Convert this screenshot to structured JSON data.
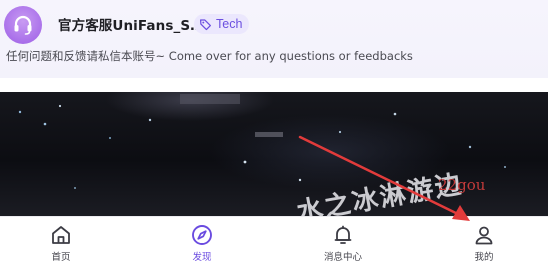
{
  "header": {
    "account_name": "官方客服UniFans_S…",
    "tag": {
      "label": "Tech",
      "icon": "tag-icon"
    },
    "bio": "任何问题和反馈请私信本账号~ Come over for any questions or feedbacks",
    "avatar_icon": "headset-icon"
  },
  "banner": {
    "watermark": "22gou",
    "overlay_text": "水之冰淋游边"
  },
  "nav": {
    "items": [
      {
        "label": "首页",
        "icon": "home-icon",
        "active": false
      },
      {
        "label": "发现",
        "icon": "compass-icon",
        "active": true
      },
      {
        "label": "消息中心",
        "icon": "bell-icon",
        "active": false
      },
      {
        "label": "我的",
        "icon": "user-icon",
        "active": false
      }
    ]
  },
  "colors": {
    "accent": "#6a4be0",
    "annotation_arrow": "#e23b3b"
  }
}
